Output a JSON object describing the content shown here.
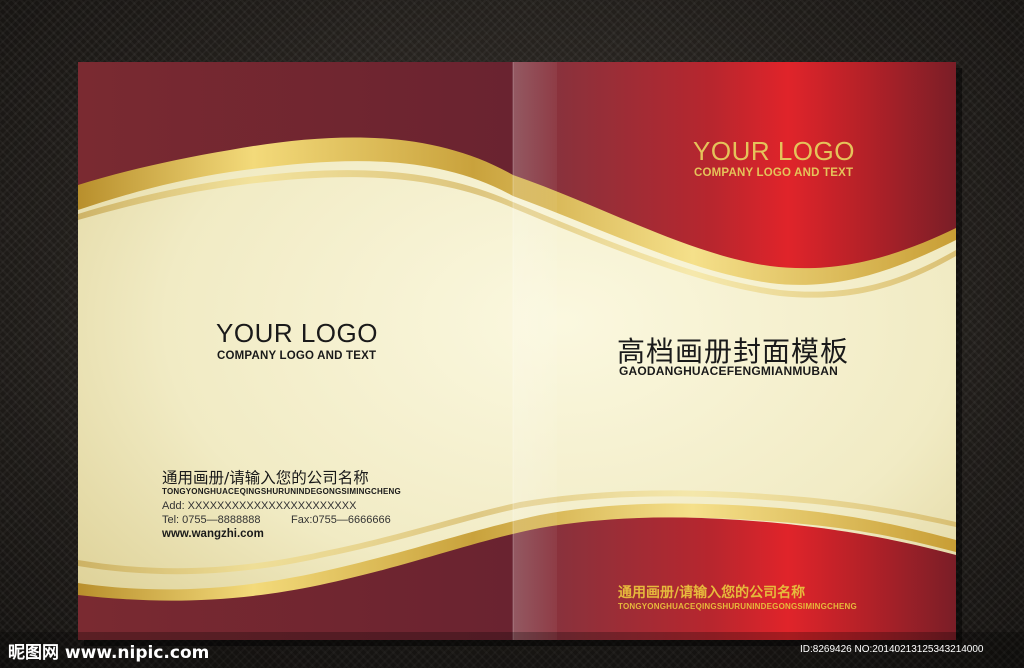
{
  "back_cover": {
    "logo": "YOUR LOGO",
    "logo_subtitle": "COMPANY LOGO AND TEXT",
    "company_name": "通用画册/请输入您的公司名称",
    "company_pinyin": "TONGYONGHUACEQINGSHURUNINDEGONGSIMINGCHENG",
    "address": "Add: XXXXXXXXXXXXXXXXXXXXXXX",
    "phone_fax": "Tel: 0755—8888888          Fax:0755—6666666",
    "website": "www.wangzhi.com"
  },
  "front_cover": {
    "logo": "YOUR LOGO",
    "logo_subtitle": "COMPANY LOGO AND TEXT",
    "title": "高档画册封面模板",
    "title_pinyin": "GAODANGHUACEFENGMIANMUBAN",
    "company_name": "通用画册/请输入您的公司名称",
    "company_pinyin": "TONGYONGHUACEQINGSHURUNINDEGONGSIMINGCHENG"
  },
  "watermark": {
    "site": "昵图网 www.nipic.com",
    "id": "ID:8269426 NO:20140213125343214000"
  },
  "colors": {
    "dark_red": "#6e2430",
    "bright_red": "#d8232a",
    "gold": "#e0c45c",
    "cream": "#f4efc9"
  }
}
